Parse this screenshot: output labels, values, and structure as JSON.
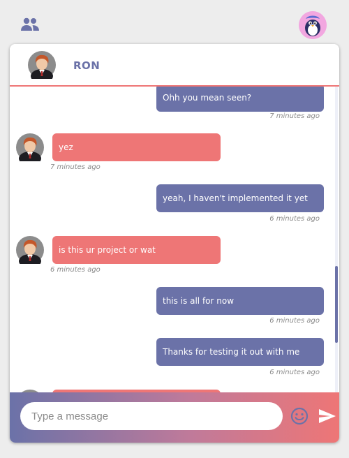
{
  "contact": {
    "name": "RON"
  },
  "messages": [
    {
      "side": "out",
      "text": "Ohh you mean seen?",
      "time": "7 minutes ago"
    },
    {
      "side": "in",
      "text": "yez",
      "time": "7 minutes ago"
    },
    {
      "side": "out",
      "text": "yeah, I haven't implemented it yet",
      "time": "6 minutes ago"
    },
    {
      "side": "in",
      "text": "is this ur project or wat",
      "time": "6 minutes ago"
    },
    {
      "side": "out",
      "text": "this is all for now",
      "time": "6 minutes ago"
    },
    {
      "side": "out",
      "text": "Thanks for testing it out with me",
      "time": "6 minutes ago"
    }
  ],
  "composer": {
    "placeholder": "Type a message"
  },
  "icons": {
    "people": "people-icon",
    "emoji": "emoji-icon",
    "send": "send-icon"
  },
  "colors": {
    "accent": "#6b72a8",
    "incoming": "#ee7676",
    "background": "#ededed"
  }
}
